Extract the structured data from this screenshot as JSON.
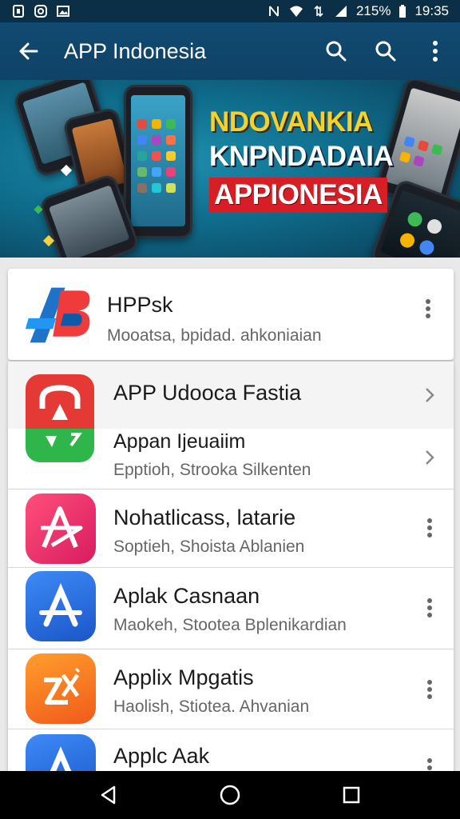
{
  "status_bar": {
    "battery_percent": "215%",
    "time": "19:35"
  },
  "app_bar": {
    "title": "APP Indonesia",
    "actions": [
      "search-icon",
      "search-icon",
      "more-vert-icon"
    ]
  },
  "banner": {
    "line1": "NDOVANKIA",
    "line2": "KNPNDADAIA",
    "line3": "APPIONESIA"
  },
  "featured": {
    "name": "HPPsk",
    "subtitle": "Mooatsa, bpidad. ahkoniaian"
  },
  "apps": [
    {
      "name": "APP Udooca Fastia",
      "subtitle": "",
      "action": "chevron-right-icon"
    },
    {
      "name": "Appan Ijeuaiim",
      "subtitle": "Epptioh, Strooka Silkenten",
      "action": "chevron-right-icon"
    },
    {
      "name": "Nohatlicass, latarie",
      "subtitle": "Soptieh, Shoista Ablanien",
      "action": "more-vert-icon"
    },
    {
      "name": "Aplak Casnaan",
      "subtitle": "Maokeh, Stootea Bplenikardian",
      "action": "more-vert-icon"
    },
    {
      "name": "Applix Mpgatis",
      "subtitle": "Haolish, Stiotea. Ahvanian",
      "action": "more-vert-icon"
    },
    {
      "name": "Applc Aak",
      "subtitle": "",
      "action": "more-vert-icon"
    }
  ],
  "colors": {
    "app_bar": "#114a72",
    "status_bar": "#0c2f48",
    "banner_yellow": "#f2d22e",
    "banner_red": "#d71e27"
  }
}
